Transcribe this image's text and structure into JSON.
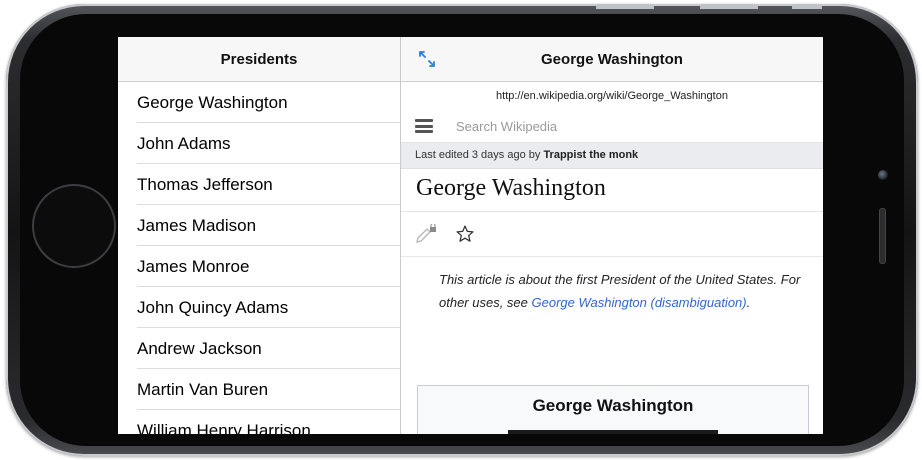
{
  "master": {
    "title": "Presidents",
    "items": [
      "George Washington",
      "John Adams",
      "Thomas Jefferson",
      "James Madison",
      "James Monroe",
      "John Quincy Adams",
      "Andrew Jackson",
      "Martin Van Buren",
      "William Henry Harrison"
    ]
  },
  "detail": {
    "title": "George Washington",
    "url": "http://en.wikipedia.org/wiki/George_Washington",
    "search_placeholder": "Search Wikipedia",
    "last_edited_prefix": "Last edited 3 days ago by ",
    "last_edited_user": "Trappist the monk",
    "article_title": "George Washington",
    "hatnote_text": "This article is about the first President of the United States. For other uses, see ",
    "hatnote_link": "George Washington (disambiguation)",
    "hatnote_end": ".",
    "infobox_title": "George Washington"
  },
  "colors": {
    "link": "#3366cc",
    "expand_icon": "#2a7de1"
  },
  "icons": {
    "expand": "expand-icon",
    "menu": "menu-icon",
    "edit": "pencil-lock-icon",
    "watch": "star-icon"
  }
}
